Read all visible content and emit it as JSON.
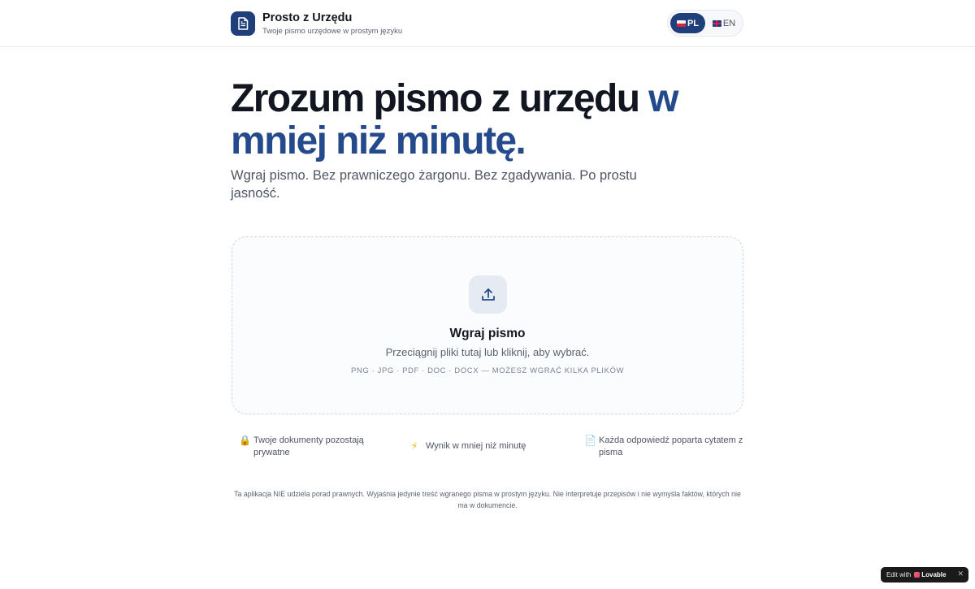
{
  "header": {
    "app_title": "Prosto z Urzędu",
    "app_subtitle": "Twoje pismo urzędowe w prostym języku",
    "logo_icon": "document-icon",
    "languages": [
      {
        "code": "PL",
        "active": true
      },
      {
        "code": "EN",
        "active": false
      }
    ]
  },
  "hero": {
    "title_main": "Zrozum pismo z urzędu",
    "title_accent": "w mniej niż minutę.",
    "subtitle": "Wgraj pismo. Bez prawniczego żargonu. Bez zgadywania. Po prostu jasność."
  },
  "upload": {
    "icon": "upload-icon",
    "title": "Wgraj pismo",
    "description": "Przeciągnij pliki tutaj lub kliknij, aby wybrać.",
    "formats": "PNG · JPG · PDF · DOC · DOCX — MOŻESZ WGRAĆ KILKA PLIKÓW"
  },
  "features": [
    {
      "icon": "lock-icon",
      "text": "Twoje dokumenty pozostają prywatne"
    },
    {
      "icon": "lightning-icon",
      "text": "Wynik w mniej niż minutę"
    },
    {
      "icon": "page-icon",
      "text": "Każda odpowiedź poparta cytatem z pisma"
    }
  ],
  "disclaimer": "Ta aplikacja NIE udziela porad prawnych. Wyjaśnia jedynie treść wgranego pisma w prostym języku. Nie interpretuje przepisów i nie wymyśla faktów, których nie ma w dokumencie.",
  "badge": {
    "prefix": "Edit with",
    "brand": "Lovable",
    "close": "✕"
  },
  "colors": {
    "accent": "#244a8c",
    "logo_bg": "#1f3f7a"
  }
}
